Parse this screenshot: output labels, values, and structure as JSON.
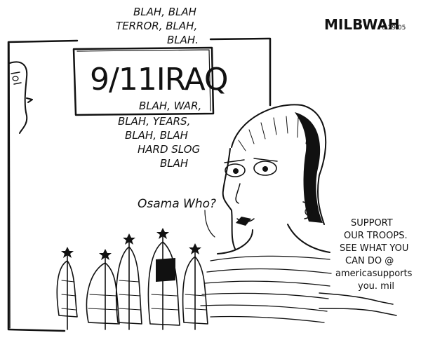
{
  "signature": {
    "name": "MILBWAH",
    "date": "6·29·05"
  },
  "tv_speech": {
    "lines_top": [
      "BLAH, BLAH",
      "TERROR, BLAH,",
      "BLAH."
    ],
    "headline": "9/11IRAQ",
    "lines_bottom": [
      "BLAH, WAR,",
      "BLAH, YEARS,",
      "BLAH, BLAH",
      "HARD SLOG",
      "BLAH"
    ]
  },
  "viewer_speech": "Osama Who?",
  "caption": [
    "SUPPORT",
    "OUR TROOPS.",
    "SEE WHAT YOU",
    "CAN DO @",
    "americasupports",
    "you. mil"
  ],
  "colors": {
    "ink": "#111111",
    "paper": "#ffffff"
  }
}
